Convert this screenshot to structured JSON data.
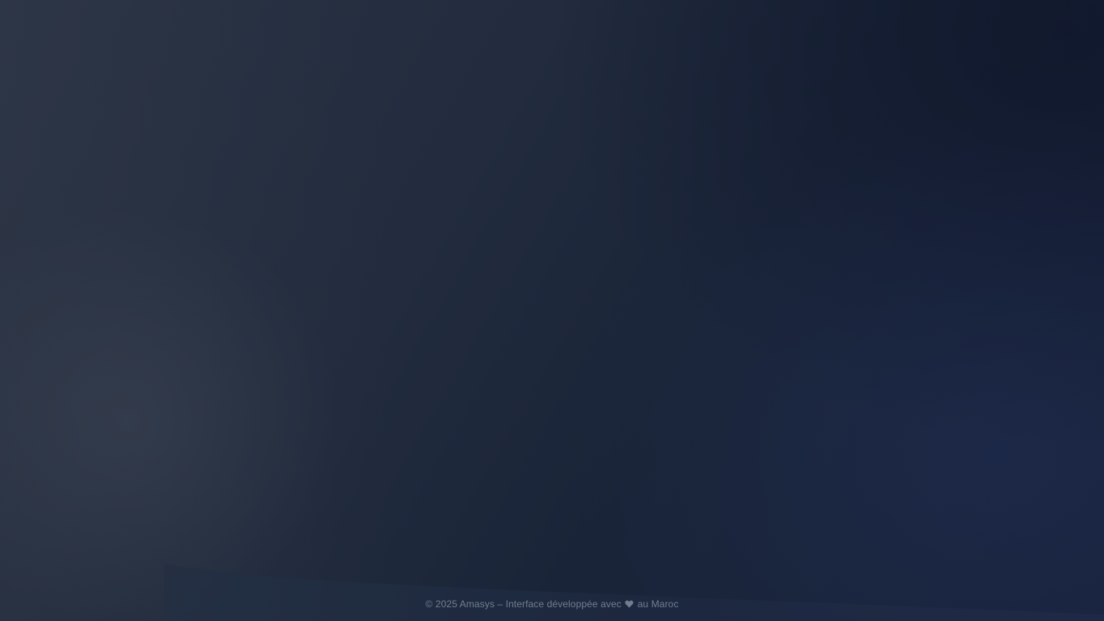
{
  "footer": {
    "prefix": "© 2025 Amasys – Interface développée avec",
    "heart_icon": "heart-icon",
    "suffix": "au Maroc",
    "text_color": "#737d8f"
  },
  "colors": {
    "background_dark": "#1a2436",
    "background_left": "#2a3344",
    "wave_fill": "#1e2a3f"
  }
}
